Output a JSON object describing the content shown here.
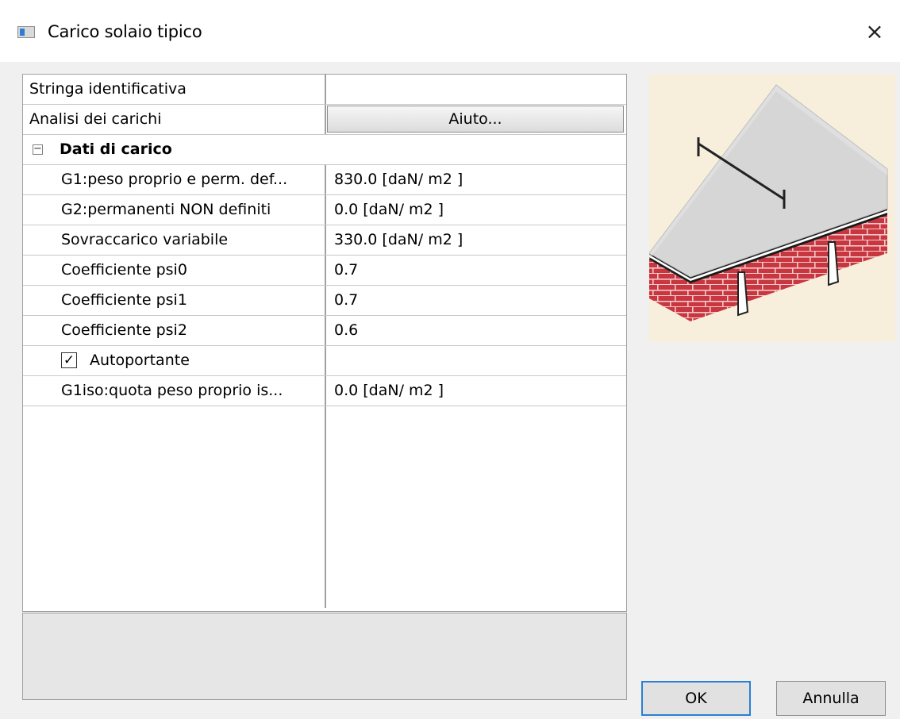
{
  "window": {
    "title": "Carico solaio tipico",
    "close_glyph": "×",
    "icon": "window-app-icon"
  },
  "grid": {
    "rows_top": [
      {
        "name": "Stringa identificativa",
        "value": ""
      }
    ],
    "analysis": {
      "name": "Analisi dei carichi",
      "button_label": "Aiuto..."
    },
    "category": {
      "label": "Dati di carico",
      "expander_glyph": "−",
      "expanded": true
    },
    "params": [
      {
        "name": "G1:peso proprio e perm. def...",
        "value": "830.0  [daN/ m2 ]"
      },
      {
        "name": "G2:permanenti NON definiti",
        "value": "0.0  [daN/ m2 ]"
      },
      {
        "name": "Sovraccarico variabile",
        "value": "330.0  [daN/ m2 ]"
      },
      {
        "name": "Coefficiente psi0",
        "value": "0.7"
      },
      {
        "name": "Coefficiente psi1",
        "value": "0.7"
      },
      {
        "name": "Coefficiente psi2",
        "value": "0.6"
      }
    ],
    "checkbox": {
      "label": "Autoportante",
      "checked": true,
      "glyph": "✓"
    },
    "last_param": {
      "name": "G1iso:quota peso proprio is...",
      "value": "0.0  [daN/ m2 ]"
    }
  },
  "preview": {
    "icon": "floor-slab-preview"
  },
  "buttons": {
    "ok": "OK",
    "cancel": "Annulla"
  },
  "colors": {
    "accent": "#2a7fd4",
    "brick": "#c8373f",
    "slab": "#d8d8d8",
    "preview_bg": "#f7efdc"
  }
}
